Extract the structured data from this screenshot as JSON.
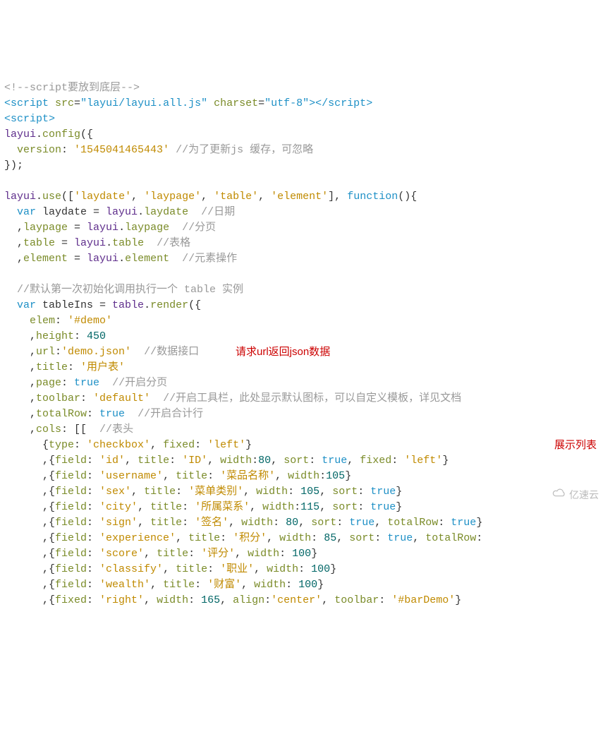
{
  "code": {
    "l1": {
      "a": "<!--",
      "b": "script",
      "c": "要放到底层",
      "d": "-->"
    },
    "l2": {
      "a": "<",
      "b": "script",
      "c": " src",
      "d": "=",
      "e": "\"layui/layui.all.js\"",
      "f": " charset",
      "g": "=",
      "h": "\"utf-8\"",
      "i": ">",
      "j": "</",
      "k": "script",
      "l": ">"
    },
    "l3": {
      "a": "<",
      "b": "script",
      "c": ">"
    },
    "l4": {
      "a": "layui",
      "b": ".",
      "c": "config",
      "d": "({"
    },
    "l5": {
      "a": "  version",
      "b": ":",
      "c": " '1545041465443'",
      "d": " //",
      "e": "为了更新",
      "f": "js",
      "g": " 缓存，可忽略"
    },
    "l6": "});",
    "l7": "",
    "l8": {
      "a": "layui",
      "b": ".",
      "c": "use",
      "d": "([",
      "e": "'laydate'",
      "f": ", ",
      "g": "'laypage'",
      "h": ", ",
      "i": "'table'",
      "j": ", ",
      "k": "'element'",
      "l": "], ",
      "m": "function",
      "n": "(){"
    },
    "l9": {
      "a": "  var",
      "b": " laydate ",
      "c": "=",
      "d": " layui",
      "e": ".",
      "f": "laydate",
      "g": "  //",
      "h": "日期"
    },
    "l10": {
      "a": "  ,",
      "b": "laypage ",
      "c": "=",
      "d": " layui",
      "e": ".",
      "f": "laypage",
      "g": "  //",
      "h": "分页"
    },
    "l11": {
      "a": "  ,",
      "b": "table ",
      "c": "=",
      "d": " layui",
      "e": ".",
      "f": "table",
      "g": "  //",
      "h": "表格"
    },
    "l12": {
      "a": "  ,",
      "b": "element ",
      "c": "=",
      "d": " layui",
      "e": ".",
      "f": "element",
      "g": "  //",
      "h": "元素操作"
    },
    "l13": "",
    "l14": {
      "a": "  //",
      "b": "默认第一次初始化调用执行一个 ",
      "c": "table",
      "d": " 实例"
    },
    "l15": {
      "a": "  var",
      "b": " tableIns ",
      "c": "=",
      "d": " table",
      "e": ".",
      "f": "render",
      "g": "({"
    },
    "l16": {
      "a": "    elem",
      "b": ":",
      "c": " '#demo'"
    },
    "l17": {
      "a": "    ,",
      "b": "height",
      "c": ":",
      "d": " 450"
    },
    "l18": {
      "a": "    ,",
      "b": "url",
      "c": ":",
      "d": "'demo.json'",
      "e": "  //",
      "f": "数据接口"
    },
    "l19": {
      "a": "    ,",
      "b": "title",
      "c": ":",
      "d": " '用户表'"
    },
    "l20": {
      "a": "    ,",
      "b": "page",
      "c": ":",
      "d": " true",
      "e": "  //",
      "f": "开启分页"
    },
    "l21": {
      "a": "    ,",
      "b": "toolbar",
      "c": ":",
      "d": " 'default'",
      "e": "  //",
      "f": "开启工具栏，此处显示默认图标，可以自定义模板，详见文档"
    },
    "l22": {
      "a": "    ,",
      "b": "totalRow",
      "c": ":",
      "d": " true",
      "e": "  //",
      "f": "开启合计行"
    },
    "l23": {
      "a": "    ,",
      "b": "cols",
      "c": ": [[  ",
      "d": "//",
      "e": "表头"
    },
    "l24": {
      "a": "      {",
      "b": "type",
      "c": ": ",
      "d": "'checkbox'",
      "e": ", ",
      "f": "fixed",
      "g": ": ",
      "h": "'left'",
      "i": "}"
    },
    "l25": {
      "a": "      ,{",
      "b": "field",
      "c": ": ",
      "d": "'id'",
      "e": ", ",
      "f": "title",
      "g": ": ",
      "h": "'ID'",
      "i": ", ",
      "j": "width",
      "k": ":",
      "l": "80",
      "m": ", ",
      "n": "sort",
      "o": ": ",
      "p": "true",
      "q": ", ",
      "r": "fixed",
      "s": ": ",
      "t": "'left'",
      "u": "}"
    },
    "l26": {
      "a": "      ,{",
      "b": "field",
      "c": ": ",
      "d": "'username'",
      "e": ", ",
      "f": "title",
      "g": ": ",
      "h": "'菜品名称'",
      "i": ", ",
      "j": "width",
      "k": ":",
      "l": "105",
      "m": "}"
    },
    "l27": {
      "a": "      ,{",
      "b": "field",
      "c": ": ",
      "d": "'sex'",
      "e": ", ",
      "f": "title",
      "g": ": ",
      "h": "'菜单类别'",
      "i": ", ",
      "j": "width",
      "k": ": ",
      "l": "105",
      "m": ", ",
      "n": "sort",
      "o": ": ",
      "p": "true",
      "q": "}"
    },
    "l28": {
      "a": "      ,{",
      "b": "field",
      "c": ": ",
      "d": "'city'",
      "e": ", ",
      "f": "title",
      "g": ": ",
      "h": "'所属菜系'",
      "i": ", ",
      "j": "width",
      "k": ":",
      "l": "115",
      "m": ", ",
      "n": "sort",
      "o": ": ",
      "p": "true",
      "q": "}"
    },
    "l29": {
      "a": "      ,{",
      "b": "field",
      "c": ": ",
      "d": "'sign'",
      "e": ", ",
      "f": "title",
      "g": ": ",
      "h": "'签名'",
      "i": ", ",
      "j": "width",
      "k": ": ",
      "l": "80",
      "m": ", ",
      "n": "sort",
      "o": ": ",
      "p": "true",
      "q": ", ",
      "r": "totalRow",
      "s": ": ",
      "t": "true",
      "u": "}"
    },
    "l30": {
      "a": "      ,{",
      "b": "field",
      "c": ": ",
      "d": "'experience'",
      "e": ", ",
      "f": "title",
      "g": ": ",
      "h": "'积分'",
      "i": ", ",
      "j": "width",
      "k": ": ",
      "l": "85",
      "m": ", ",
      "n": "sort",
      "o": ": ",
      "p": "true",
      "q": ", ",
      "r": "totalRow",
      "s": ":"
    },
    "l31": {
      "a": "      ,{",
      "b": "field",
      "c": ": ",
      "d": "'score'",
      "e": ", ",
      "f": "title",
      "g": ": ",
      "h": "'评分'",
      "i": ", ",
      "j": "width",
      "k": ": ",
      "l": "100",
      "m": "}"
    },
    "l32": {
      "a": "      ,{",
      "b": "field",
      "c": ": ",
      "d": "'classify'",
      "e": ", ",
      "f": "title",
      "g": ": ",
      "h": "'职业'",
      "i": ", ",
      "j": "width",
      "k": ": ",
      "l": "100",
      "m": "}"
    },
    "l33": {
      "a": "      ,{",
      "b": "field",
      "c": ": ",
      "d": "'wealth'",
      "e": ", ",
      "f": "title",
      "g": ": ",
      "h": "'财富'",
      "i": ", ",
      "j": "width",
      "k": ": ",
      "l": "100",
      "m": "}"
    },
    "l34": {
      "a": "      ,{",
      "b": "fixed",
      "c": ": ",
      "d": "'right'",
      "e": ", ",
      "f": "width",
      "g": ": ",
      "h": "165",
      "i": ", ",
      "j": "align",
      "k": ":",
      "l": "'center'",
      "m": ", ",
      "n": "toolbar",
      "o": ": ",
      "p": "'#barDemo'",
      "q": "}"
    }
  },
  "annotations": {
    "url_note": "请求url返回json数据",
    "cols_note": "展示列表"
  },
  "watermark": "亿速云"
}
